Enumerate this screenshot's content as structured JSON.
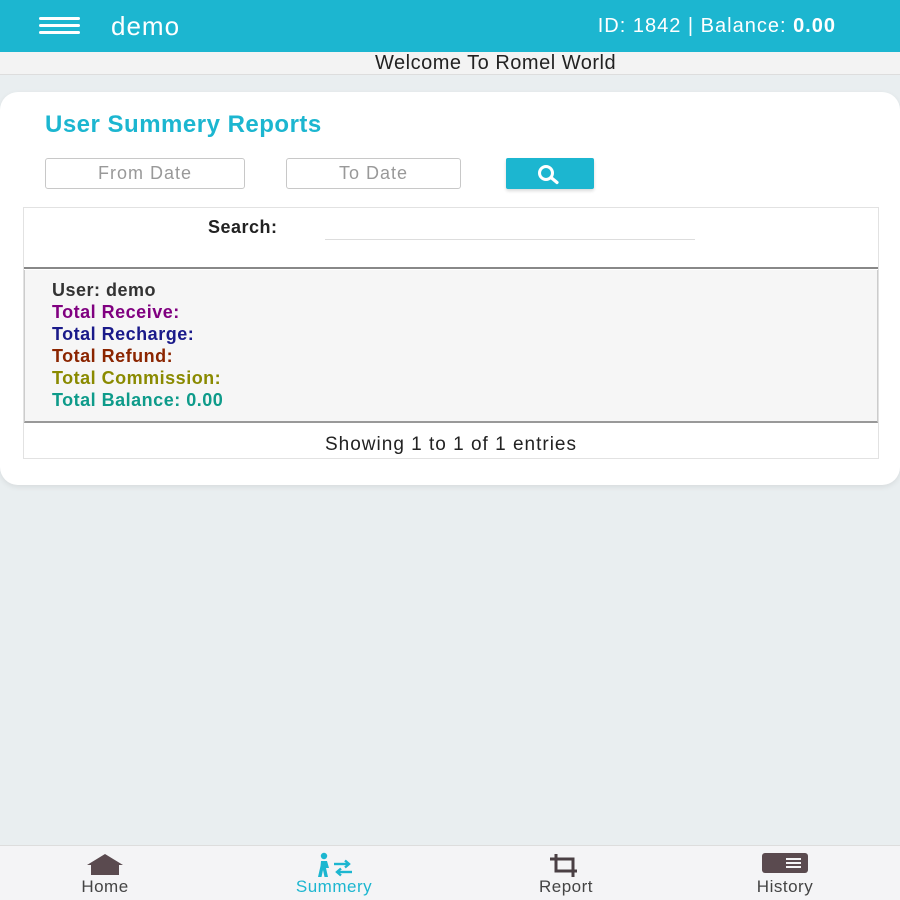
{
  "header": {
    "title": "demo",
    "account_prefix": "ID: 1842 | Balance: ",
    "balance": "0.00"
  },
  "marquee": {
    "text": "Welcome To Romel World"
  },
  "report": {
    "title": "User Summery Reports",
    "from_placeholder": "From Date",
    "to_placeholder": "To Date",
    "search_label": "Search:",
    "search_value": "",
    "row": {
      "user": "User: demo",
      "total_receive": "Total Receive:",
      "total_recharge": "Total Recharge:",
      "total_refund": "Total Refund:",
      "total_commission": "Total Commission:",
      "total_balance": "Total Balance: 0.00"
    },
    "entries_info": "Showing 1 to 1 of 1 entries"
  },
  "nav": {
    "items": [
      {
        "label": "Home",
        "icon": "home-icon"
      },
      {
        "label": "Summery",
        "icon": "person-transfer-icon",
        "active": true
      },
      {
        "label": "Report",
        "icon": "crop-icon"
      },
      {
        "label": "History",
        "icon": "card-icon"
      }
    ]
  },
  "colors": {
    "accent": "#1cb6d0",
    "receive": "#800080",
    "recharge": "#1a1a8a",
    "refund": "#8b2500",
    "commission": "#8a8a00",
    "balance": "#0e9b8a"
  }
}
